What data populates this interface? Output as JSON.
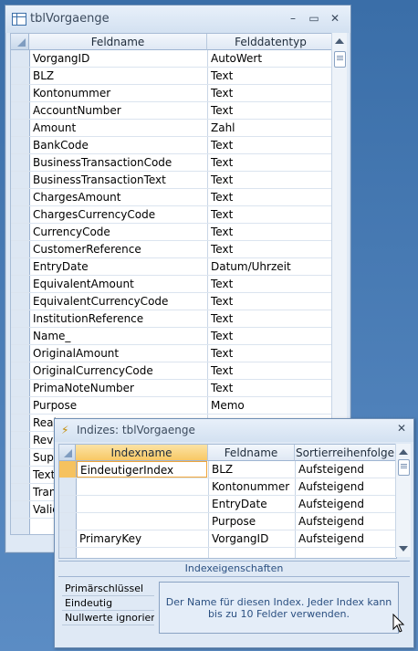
{
  "main_window": {
    "title": "tblVorgaenge",
    "minimize": "–",
    "maximize": "▭",
    "close": "✕",
    "columns": [
      "Feldname",
      "Felddatentyp"
    ],
    "rows": [
      {
        "name": "VorgangID",
        "type": "AutoWert"
      },
      {
        "name": "BLZ",
        "type": "Text"
      },
      {
        "name": "Kontonummer",
        "type": "Text"
      },
      {
        "name": "AccountNumber",
        "type": "Text"
      },
      {
        "name": "Amount",
        "type": "Zahl"
      },
      {
        "name": "BankCode",
        "type": "Text"
      },
      {
        "name": "BusinessTransactionCode",
        "type": "Text"
      },
      {
        "name": "BusinessTransactionText",
        "type": "Text"
      },
      {
        "name": "ChargesAmount",
        "type": "Text"
      },
      {
        "name": "ChargesCurrencyCode",
        "type": "Text"
      },
      {
        "name": "CurrencyCode",
        "type": "Text"
      },
      {
        "name": "CustomerReference",
        "type": "Text"
      },
      {
        "name": "EntryDate",
        "type": "Datum/Uhrzeit"
      },
      {
        "name": "EquivalentAmount",
        "type": "Text"
      },
      {
        "name": "EquivalentCurrencyCode",
        "type": "Text"
      },
      {
        "name": "InstitutionReference",
        "type": "Text"
      },
      {
        "name": "Name_",
        "type": "Text"
      },
      {
        "name": "OriginalAmount",
        "type": "Text"
      },
      {
        "name": "OriginalCurrencyCode",
        "type": "Text"
      },
      {
        "name": "PrimaNoteNumber",
        "type": "Text"
      },
      {
        "name": "Purpose",
        "type": "Memo"
      },
      {
        "name": "Real",
        "type": ""
      },
      {
        "name": "Reve",
        "type": ""
      },
      {
        "name": "Supp",
        "type": ""
      },
      {
        "name": "Text",
        "type": ""
      },
      {
        "name": "Tran",
        "type": ""
      },
      {
        "name": "Valid",
        "type": ""
      },
      {
        "name": "",
        "type": ""
      }
    ]
  },
  "index_dialog": {
    "title": "Indizes: tblVorgaenge",
    "close": "✕",
    "columns": [
      "Indexname",
      "Feldname",
      "Sortierreihenfolge"
    ],
    "rows": [
      {
        "index": "EindeutigerIndex",
        "field": "BLZ",
        "order": "Aufsteigend"
      },
      {
        "index": "",
        "field": "Kontonummer",
        "order": "Aufsteigend"
      },
      {
        "index": "",
        "field": "EntryDate",
        "order": "Aufsteigend"
      },
      {
        "index": "",
        "field": "Purpose",
        "order": "Aufsteigend"
      },
      {
        "index": "PrimaryKey",
        "field": "VorgangID",
        "order": "Aufsteigend"
      },
      {
        "index": "",
        "field": "",
        "order": ""
      }
    ],
    "properties_title": "Indexeigenschaften",
    "properties": [
      "Primärschlüssel",
      "Eindeutig",
      "Nullwerte ignorieren"
    ],
    "help_text": "Der Name für diesen Index. Jeder Index kann bis zu 10 Felder verwenden."
  }
}
